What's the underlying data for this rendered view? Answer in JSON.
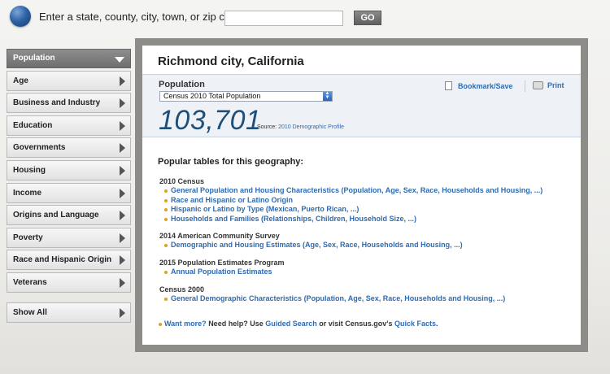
{
  "search": {
    "label": "Enter a state, county, city, town, or zip code:",
    "value": "",
    "go_label": "GO"
  },
  "sidebar": {
    "items": [
      {
        "label": "Population",
        "active": true
      },
      {
        "label": "Age"
      },
      {
        "label": "Business and Industry"
      },
      {
        "label": "Education"
      },
      {
        "label": "Governments"
      },
      {
        "label": "Housing"
      },
      {
        "label": "Income"
      },
      {
        "label": "Origins and Language"
      },
      {
        "label": "Poverty"
      },
      {
        "label": "Race and Hispanic Origin"
      },
      {
        "label": "Veterans"
      }
    ],
    "show_all": "Show All"
  },
  "main": {
    "title": "Richmond city, California",
    "population": {
      "label": "Population",
      "select_value": "Census 2010 Total Population",
      "value": "103,701",
      "source_label": "Source:",
      "source_link": "2010 Demographic Profile"
    },
    "actions": {
      "bookmark": "Bookmark/Save",
      "print": "Print"
    },
    "popular_title": "Popular tables for this geography:",
    "sections": [
      {
        "heading": "2010 Census",
        "links": [
          "General Population and Housing Characteristics (Population, Age, Sex, Race, Households and Housing, ...)",
          "Race and Hispanic or Latino Origin",
          "Hispanic or Latino by Type (Mexican, Puerto Rican, ...)",
          "Households and Families (Relationships, Children, Household Size, ...)"
        ]
      },
      {
        "heading": "2014 American Community Survey",
        "links": [
          "Demographic and Housing Estimates (Age, Sex, Race, Households and Housing, ...)"
        ]
      },
      {
        "heading": "2015 Population Estimates Program",
        "links": [
          "Annual Population Estimates"
        ]
      },
      {
        "heading": "Census 2000",
        "links": [
          "General Demographic Characteristics (Population, Age, Sex, Race, Households and Housing, ...)"
        ]
      }
    ],
    "more": {
      "want_more": "Want more?",
      "need_help": "Need help? Use",
      "guided_search": "Guided Search",
      "or_visit": "or visit Census.gov's",
      "quick_facts": "Quick Facts",
      "period": "."
    }
  }
}
